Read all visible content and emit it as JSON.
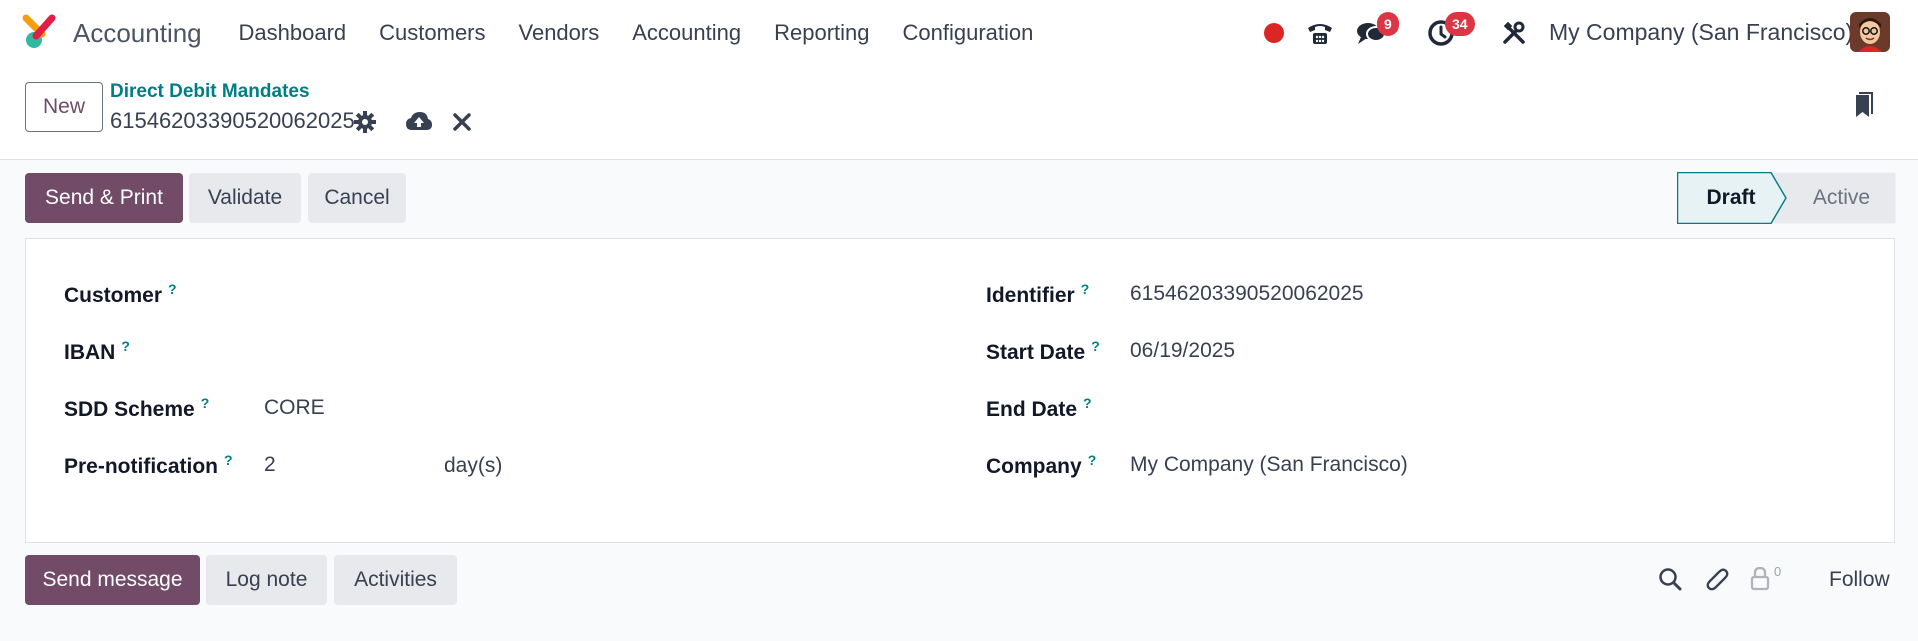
{
  "navbar": {
    "app_name": "Accounting",
    "menu": [
      "Dashboard",
      "Customers",
      "Vendors",
      "Accounting",
      "Reporting",
      "Configuration"
    ],
    "messages_count": "9",
    "activities_count": "34",
    "company": "My Company (San Francisco)",
    "colors": {
      "record": "#dc2626",
      "badge": "#dc3545"
    }
  },
  "control_panel": {
    "new_label": "New",
    "breadcrumb": "Direct Debit Mandates",
    "record_name": "61546203390520062025"
  },
  "statusbar": {
    "buttons": {
      "send_print": "Send & Print",
      "validate": "Validate",
      "cancel": "Cancel"
    },
    "stages": {
      "draft": "Draft",
      "active": "Active"
    }
  },
  "form": {
    "left": {
      "customer_label": "Customer",
      "iban_label": "IBAN",
      "sdd_scheme_label": "SDD Scheme",
      "sdd_scheme_value": "CORE",
      "prenotification_label": "Pre-notification",
      "prenotification_value": "2",
      "prenotification_unit": "day(s)"
    },
    "right": {
      "identifier_label": "Identifier",
      "identifier_value": "61546203390520062025",
      "start_date_label": "Start Date",
      "start_date_value": "06/19/2025",
      "end_date_label": "End Date",
      "company_label": "Company",
      "company_value": "My Company (San Francisco)"
    },
    "help_mark": "?"
  },
  "chatter": {
    "send_message": "Send message",
    "log_note": "Log note",
    "activities": "Activities",
    "followers_count": "0",
    "follow": "Follow"
  },
  "colors": {
    "primary": "#714b67",
    "link": "#017e84"
  }
}
